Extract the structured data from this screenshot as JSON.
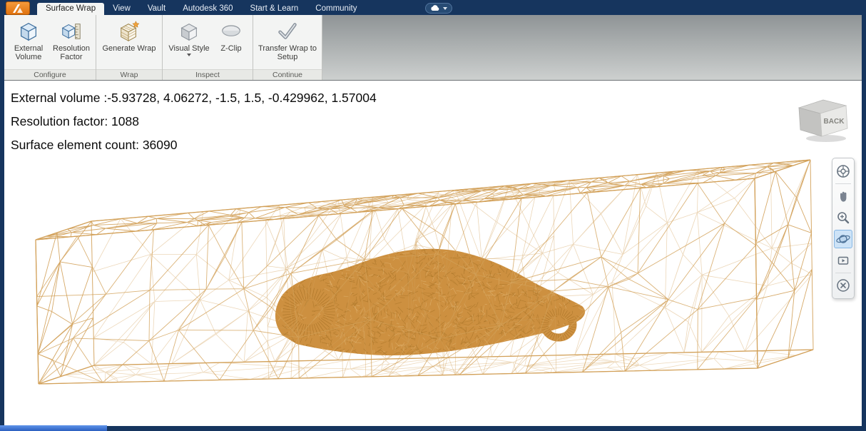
{
  "accent_colors": {
    "window_border": "#16355e",
    "app_button": "#e87a1f",
    "bottom_accent": "#3570d6"
  },
  "tabs": {
    "items": [
      {
        "label": "Surface Wrap",
        "active": true
      },
      {
        "label": "View",
        "active": false
      },
      {
        "label": "Vault",
        "active": false
      },
      {
        "label": "Autodesk 360",
        "active": false
      },
      {
        "label": "Start & Learn",
        "active": false
      },
      {
        "label": "Community",
        "active": false
      }
    ]
  },
  "ribbon": {
    "groups": [
      {
        "title": "Configure",
        "buttons": [
          {
            "label": "External Volume"
          },
          {
            "label": "Resolution Factor"
          }
        ]
      },
      {
        "title": "Wrap",
        "buttons": [
          {
            "label": "Generate Wrap"
          }
        ]
      },
      {
        "title": "Inspect",
        "buttons": [
          {
            "label": "Visual Style",
            "has_dropdown": true
          },
          {
            "label": "Z-Clip"
          }
        ]
      },
      {
        "title": "Continue",
        "buttons": [
          {
            "label": "Transfer Wrap to Setup"
          }
        ]
      }
    ]
  },
  "status": {
    "line1": "External volume :-5.93728, 4.06272, -1.5, 1.5, -0.429962, 1.57004",
    "line2": "Resolution factor: 1088",
    "line3": "Surface element count: 36090"
  },
  "viewport": {
    "viewcube_label": "BACK",
    "mesh_color": "#d2a058",
    "car_color": "#cd9040",
    "car_shadow_color": "#9c6a1e",
    "car_highlight_color": "#eeca8d"
  },
  "navbar": {
    "items": [
      "navigation-wheel",
      "pan",
      "zoom",
      "orbit",
      "show-motion",
      "close"
    ]
  }
}
